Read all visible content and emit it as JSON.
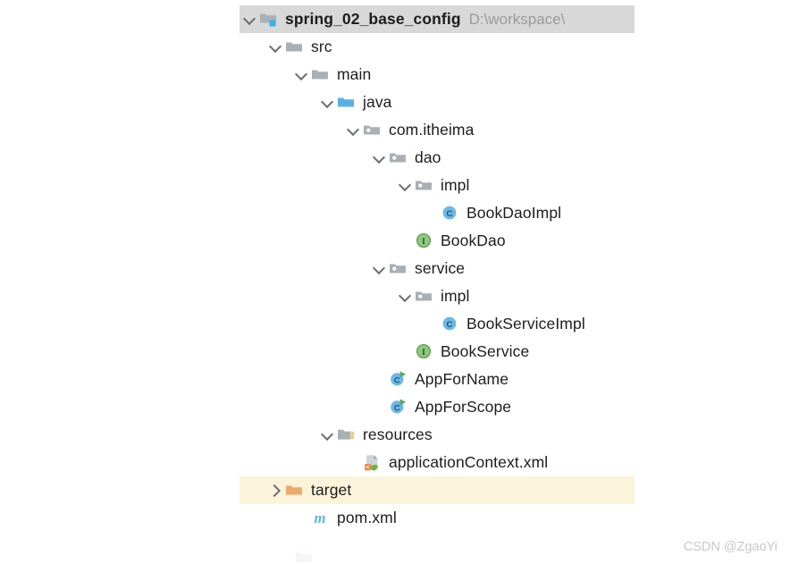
{
  "project_tree": {
    "root_path_label": "D:\\workspace\\",
    "rows": [
      {
        "label": "spring_02_base_config",
        "icon": "module-folder-icon",
        "twisty": "expanded",
        "depth": 0,
        "bold": true,
        "highlight": "gray",
        "path": "D:\\workspace\\"
      },
      {
        "label": "src",
        "icon": "folder-icon",
        "twisty": "expanded",
        "depth": 1,
        "bold": false,
        "highlight": "none",
        "path": ""
      },
      {
        "label": "main",
        "icon": "folder-icon",
        "twisty": "expanded",
        "depth": 2,
        "bold": false,
        "highlight": "none",
        "path": ""
      },
      {
        "label": "java",
        "icon": "source-folder-icon",
        "twisty": "expanded",
        "depth": 3,
        "bold": false,
        "highlight": "none",
        "path": ""
      },
      {
        "label": "com.itheima",
        "icon": "package-icon",
        "twisty": "expanded",
        "depth": 4,
        "bold": false,
        "highlight": "none",
        "path": ""
      },
      {
        "label": "dao",
        "icon": "package-icon",
        "twisty": "expanded",
        "depth": 5,
        "bold": false,
        "highlight": "none",
        "path": ""
      },
      {
        "label": "impl",
        "icon": "package-icon",
        "twisty": "expanded",
        "depth": 6,
        "bold": false,
        "highlight": "none",
        "path": ""
      },
      {
        "label": "BookDaoImpl",
        "icon": "java-class-icon",
        "twisty": "none",
        "depth": 7,
        "bold": false,
        "highlight": "none",
        "path": ""
      },
      {
        "label": "BookDao",
        "icon": "java-interface-icon",
        "twisty": "none",
        "depth": 6,
        "bold": false,
        "highlight": "none",
        "path": ""
      },
      {
        "label": "service",
        "icon": "package-icon",
        "twisty": "expanded",
        "depth": 5,
        "bold": false,
        "highlight": "none",
        "path": ""
      },
      {
        "label": "impl",
        "icon": "package-icon",
        "twisty": "expanded",
        "depth": 6,
        "bold": false,
        "highlight": "none",
        "path": ""
      },
      {
        "label": "BookServiceImpl",
        "icon": "java-class-icon",
        "twisty": "none",
        "depth": 7,
        "bold": false,
        "highlight": "none",
        "path": ""
      },
      {
        "label": "BookService",
        "icon": "java-interface-icon",
        "twisty": "none",
        "depth": 6,
        "bold": false,
        "highlight": "none",
        "path": ""
      },
      {
        "label": "AppForName",
        "icon": "runnable-class-icon",
        "twisty": "none",
        "depth": 5,
        "bold": false,
        "highlight": "none",
        "path": ""
      },
      {
        "label": "AppForScope",
        "icon": "runnable-class-icon",
        "twisty": "none",
        "depth": 5,
        "bold": false,
        "highlight": "none",
        "path": ""
      },
      {
        "label": "resources",
        "icon": "resource-folder-icon",
        "twisty": "expanded",
        "depth": 3,
        "bold": false,
        "highlight": "none",
        "path": ""
      },
      {
        "label": "applicationContext.xml",
        "icon": "spring-xml-icon",
        "twisty": "none",
        "depth": 4,
        "bold": false,
        "highlight": "none",
        "path": ""
      },
      {
        "label": "target",
        "icon": "excluded-folder-icon",
        "twisty": "collapsed",
        "depth": 1,
        "bold": false,
        "highlight": "cream",
        "path": ""
      },
      {
        "label": "pom.xml",
        "icon": "maven-pom-icon",
        "twisty": "none",
        "depth": 2,
        "bold": false,
        "highlight": "none",
        "path": ""
      }
    ]
  },
  "watermark": {
    "text": "CSDN @ZgaoYi"
  },
  "colors": {
    "folder_gray": "#a9b0b5",
    "folder_blue": "#59b0e6",
    "folder_orange": "#f0a868",
    "class_blue": "#6cb8e6",
    "interface_green": "#8fc97f",
    "run_badge_green": "#59a869",
    "maven_blue": "#61b5e0",
    "highlight_gray": "#d8d8d8",
    "highlight_cream": "#fcf4da",
    "text": "#1d1d1d",
    "path_text": "#9a9a9a",
    "watermark_text": "#c7c7c7"
  }
}
